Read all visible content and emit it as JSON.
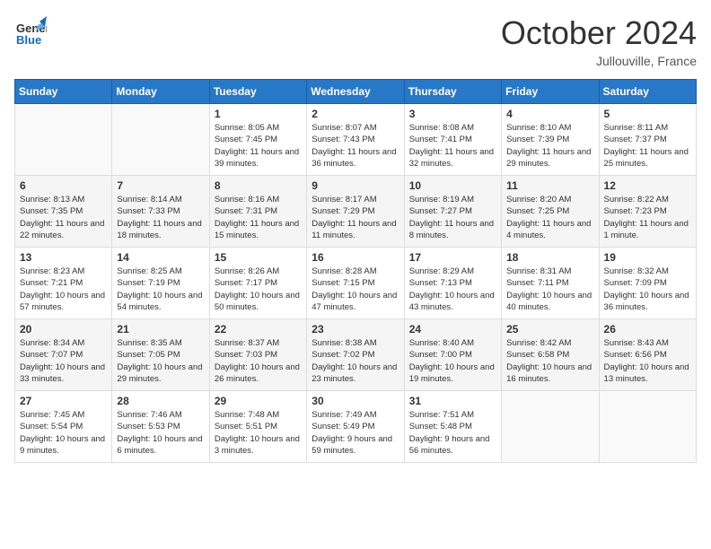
{
  "header": {
    "logo_general": "General",
    "logo_blue": "Blue",
    "month_title": "October 2024",
    "location": "Jullouville, France"
  },
  "days_of_week": [
    "Sunday",
    "Monday",
    "Tuesday",
    "Wednesday",
    "Thursday",
    "Friday",
    "Saturday"
  ],
  "weeks": [
    [
      {
        "day": "",
        "info": ""
      },
      {
        "day": "",
        "info": ""
      },
      {
        "day": "1",
        "sunrise": "8:05 AM",
        "sunset": "7:45 PM",
        "daylight": "11 hours and 39 minutes."
      },
      {
        "day": "2",
        "sunrise": "8:07 AM",
        "sunset": "7:43 PM",
        "daylight": "11 hours and 36 minutes."
      },
      {
        "day": "3",
        "sunrise": "8:08 AM",
        "sunset": "7:41 PM",
        "daylight": "11 hours and 32 minutes."
      },
      {
        "day": "4",
        "sunrise": "8:10 AM",
        "sunset": "7:39 PM",
        "daylight": "11 hours and 29 minutes."
      },
      {
        "day": "5",
        "sunrise": "8:11 AM",
        "sunset": "7:37 PM",
        "daylight": "11 hours and 25 minutes."
      }
    ],
    [
      {
        "day": "6",
        "sunrise": "8:13 AM",
        "sunset": "7:35 PM",
        "daylight": "11 hours and 22 minutes."
      },
      {
        "day": "7",
        "sunrise": "8:14 AM",
        "sunset": "7:33 PM",
        "daylight": "11 hours and 18 minutes."
      },
      {
        "day": "8",
        "sunrise": "8:16 AM",
        "sunset": "7:31 PM",
        "daylight": "11 hours and 15 minutes."
      },
      {
        "day": "9",
        "sunrise": "8:17 AM",
        "sunset": "7:29 PM",
        "daylight": "11 hours and 11 minutes."
      },
      {
        "day": "10",
        "sunrise": "8:19 AM",
        "sunset": "7:27 PM",
        "daylight": "11 hours and 8 minutes."
      },
      {
        "day": "11",
        "sunrise": "8:20 AM",
        "sunset": "7:25 PM",
        "daylight": "11 hours and 4 minutes."
      },
      {
        "day": "12",
        "sunrise": "8:22 AM",
        "sunset": "7:23 PM",
        "daylight": "11 hours and 1 minute."
      }
    ],
    [
      {
        "day": "13",
        "sunrise": "8:23 AM",
        "sunset": "7:21 PM",
        "daylight": "10 hours and 57 minutes."
      },
      {
        "day": "14",
        "sunrise": "8:25 AM",
        "sunset": "7:19 PM",
        "daylight": "10 hours and 54 minutes."
      },
      {
        "day": "15",
        "sunrise": "8:26 AM",
        "sunset": "7:17 PM",
        "daylight": "10 hours and 50 minutes."
      },
      {
        "day": "16",
        "sunrise": "8:28 AM",
        "sunset": "7:15 PM",
        "daylight": "10 hours and 47 minutes."
      },
      {
        "day": "17",
        "sunrise": "8:29 AM",
        "sunset": "7:13 PM",
        "daylight": "10 hours and 43 minutes."
      },
      {
        "day": "18",
        "sunrise": "8:31 AM",
        "sunset": "7:11 PM",
        "daylight": "10 hours and 40 minutes."
      },
      {
        "day": "19",
        "sunrise": "8:32 AM",
        "sunset": "7:09 PM",
        "daylight": "10 hours and 36 minutes."
      }
    ],
    [
      {
        "day": "20",
        "sunrise": "8:34 AM",
        "sunset": "7:07 PM",
        "daylight": "10 hours and 33 minutes."
      },
      {
        "day": "21",
        "sunrise": "8:35 AM",
        "sunset": "7:05 PM",
        "daylight": "10 hours and 29 minutes."
      },
      {
        "day": "22",
        "sunrise": "8:37 AM",
        "sunset": "7:03 PM",
        "daylight": "10 hours and 26 minutes."
      },
      {
        "day": "23",
        "sunrise": "8:38 AM",
        "sunset": "7:02 PM",
        "daylight": "10 hours and 23 minutes."
      },
      {
        "day": "24",
        "sunrise": "8:40 AM",
        "sunset": "7:00 PM",
        "daylight": "10 hours and 19 minutes."
      },
      {
        "day": "25",
        "sunrise": "8:42 AM",
        "sunset": "6:58 PM",
        "daylight": "10 hours and 16 minutes."
      },
      {
        "day": "26",
        "sunrise": "8:43 AM",
        "sunset": "6:56 PM",
        "daylight": "10 hours and 13 minutes."
      }
    ],
    [
      {
        "day": "27",
        "sunrise": "7:45 AM",
        "sunset": "5:54 PM",
        "daylight": "10 hours and 9 minutes."
      },
      {
        "day": "28",
        "sunrise": "7:46 AM",
        "sunset": "5:53 PM",
        "daylight": "10 hours and 6 minutes."
      },
      {
        "day": "29",
        "sunrise": "7:48 AM",
        "sunset": "5:51 PM",
        "daylight": "10 hours and 3 minutes."
      },
      {
        "day": "30",
        "sunrise": "7:49 AM",
        "sunset": "5:49 PM",
        "daylight": "9 hours and 59 minutes."
      },
      {
        "day": "31",
        "sunrise": "7:51 AM",
        "sunset": "5:48 PM",
        "daylight": "9 hours and 56 minutes."
      },
      {
        "day": "",
        "info": ""
      },
      {
        "day": "",
        "info": ""
      }
    ]
  ],
  "labels": {
    "sunrise": "Sunrise:",
    "sunset": "Sunset:",
    "daylight": "Daylight:"
  }
}
